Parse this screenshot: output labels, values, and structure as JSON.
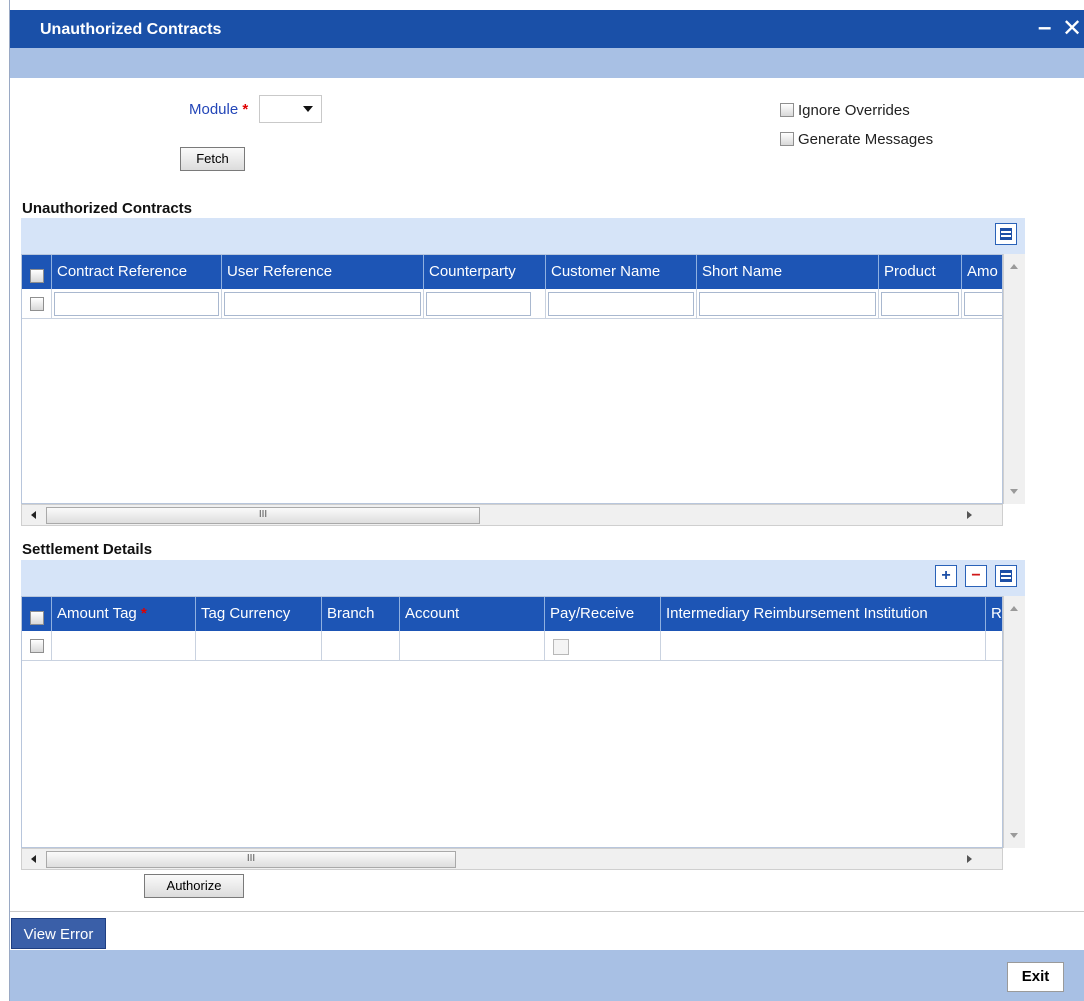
{
  "window": {
    "title": "Unauthorized Contracts",
    "minimize": "–",
    "close": "✕"
  },
  "form": {
    "module_label": "Module",
    "required_mark": "*",
    "module_value": "",
    "fetch_label": "Fetch",
    "ignore_overrides": {
      "label": "Ignore Overrides",
      "checked": false
    },
    "generate_messages": {
      "label": "Generate Messages",
      "checked": false
    }
  },
  "contracts": {
    "title": "Unauthorized Contracts",
    "columns": [
      "Contract Reference",
      "User Reference",
      "Counterparty",
      "Customer Name",
      "Short Name",
      "Product",
      "Amo"
    ],
    "rows": [
      [
        "",
        "",
        "",
        "",
        "",
        "",
        ""
      ]
    ],
    "scroll_thumb": "III"
  },
  "settlement": {
    "title": "Settlement Details",
    "columns": [
      "Amount Tag",
      "Tag Currency",
      "Branch",
      "Account",
      "Pay/Receive",
      "Intermediary Reimbursement Institution",
      "R"
    ],
    "amount_tag_required": "*",
    "rows": [
      [
        "",
        "",
        "",
        "",
        "",
        "",
        ""
      ]
    ],
    "scroll_thumb": "III",
    "add_icon": "+",
    "remove_icon": "−"
  },
  "authorize_label": "Authorize",
  "view_error_label": "View Error",
  "exit_label": "Exit"
}
